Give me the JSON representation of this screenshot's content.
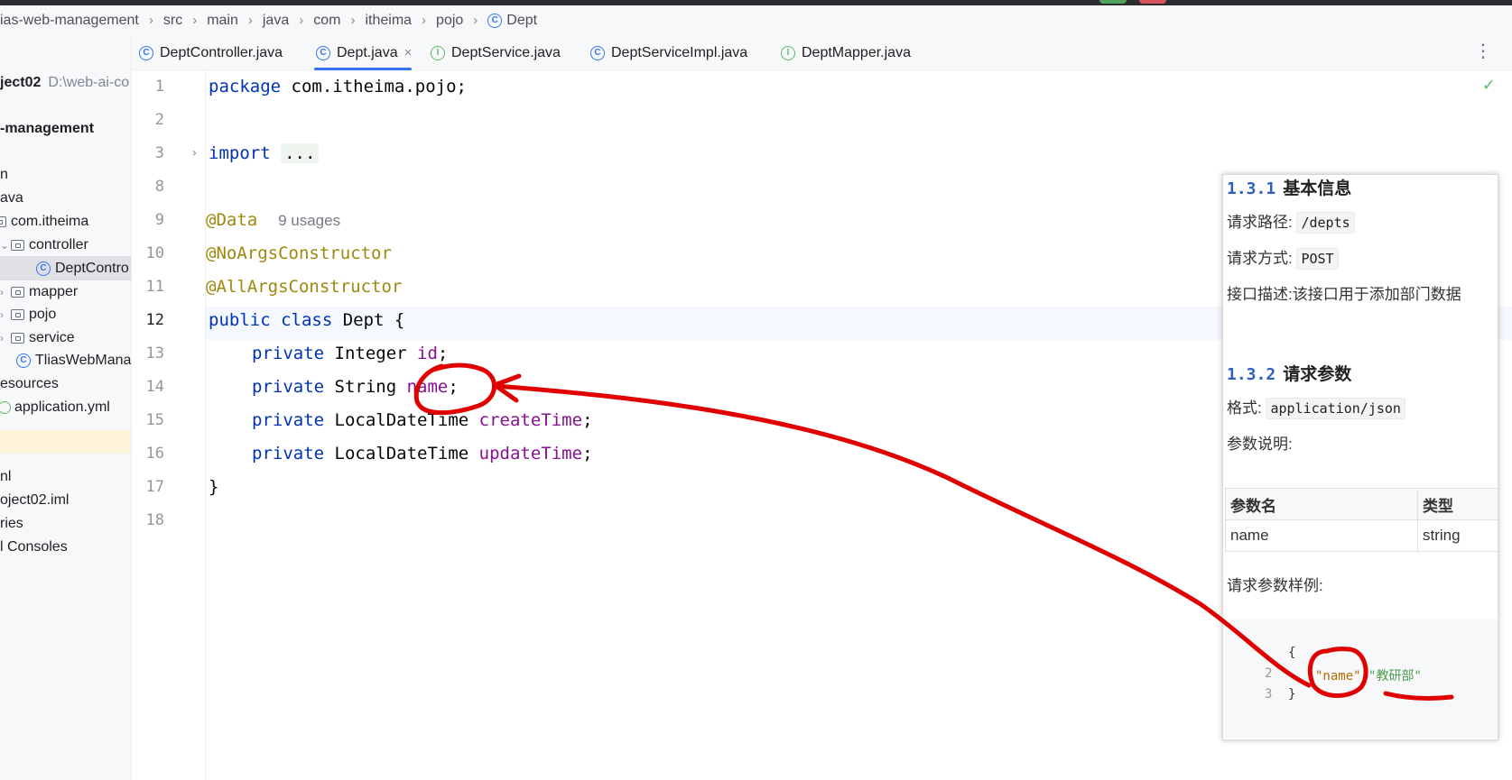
{
  "breadcrumb": [
    "ias-web-management",
    "src",
    "main",
    "java",
    "com",
    "itheima",
    "pojo",
    "Dept"
  ],
  "sidebar": {
    "project_name": "ject02",
    "project_path": "D:\\web-ai-co",
    "module": "-management",
    "items": [
      {
        "label": "n"
      },
      {
        "label": "ava"
      },
      {
        "label": "com.itheima"
      },
      {
        "label": "controller"
      },
      {
        "label": "DeptContro"
      },
      {
        "label": "mapper"
      },
      {
        "label": "pojo"
      },
      {
        "label": "service"
      },
      {
        "label": "TliasWebMana"
      },
      {
        "label": "esources"
      },
      {
        "label": "application.yml"
      },
      {
        "label": "nl"
      },
      {
        "label": "oject02.iml"
      },
      {
        "label": "ries"
      },
      {
        "label": "l Consoles"
      }
    ]
  },
  "tabs": [
    {
      "label": "DeptController.java",
      "icon": "class-icon"
    },
    {
      "label": "Dept.java",
      "icon": "class-icon",
      "active": true
    },
    {
      "label": "DeptService.java",
      "icon": "interface-icon"
    },
    {
      "label": "DeptServiceImpl.java",
      "icon": "class-icon"
    },
    {
      "label": "DeptMapper.java",
      "icon": "interface-icon"
    }
  ],
  "editor": {
    "line_numbers": [
      "1",
      "2",
      "3",
      "8",
      "9",
      "10",
      "11",
      "12",
      "13",
      "14",
      "15",
      "16",
      "17",
      "18"
    ],
    "current_line": "12",
    "code": {
      "l1_kw": "package",
      "l1_rest": " com.itheima.pojo;",
      "l3_kw": "import",
      "l3_fold": "...",
      "l9_ann": "@Data",
      "l9_hint": "9 usages",
      "l10_ann": "@NoArgsConstructor",
      "l11_ann": "@AllArgsConstructor",
      "l12_kw": "public class",
      "l12_rest": " Dept {",
      "private_kw": "private",
      "l13_type": " Integer ",
      "l13_field": "id",
      "l14_type": " String ",
      "l14_field": "name",
      "l15_type": " LocalDateTime ",
      "l15_field": "createTime",
      "l16_type": " LocalDateTime ",
      "l16_field": "updateTime",
      "semicolon": ";",
      "l17": "}"
    }
  },
  "doc": {
    "s1_num": "1.3.1",
    "s1_title": "基本信息",
    "path_label": "请求路径:",
    "path_value": "/depts",
    "method_label": "请求方式:",
    "method_value": "POST",
    "desc_label": "接口描述:",
    "desc_value": "该接口用于添加部门数据",
    "s2_num": "1.3.2",
    "s2_title": "请求参数",
    "format_label": "格式:",
    "format_value": "application/json",
    "params_label": "参数说明:",
    "table_headers": [
      "参数名",
      "类型"
    ],
    "table_rows": [
      [
        "name",
        "string"
      ]
    ],
    "sample_label": "请求参数样例:",
    "json_lines": [
      {
        "num": "",
        "text": "{"
      },
      {
        "num": "2",
        "key": "\"name\"",
        "value": "\"教研部\""
      },
      {
        "num": "3",
        "text": "}"
      }
    ]
  },
  "colors": {
    "accent": "#3574f0",
    "keyword": "#0033b3",
    "annotation": "#9e880d",
    "field": "#871094",
    "annotation_ink": "#e00000"
  }
}
